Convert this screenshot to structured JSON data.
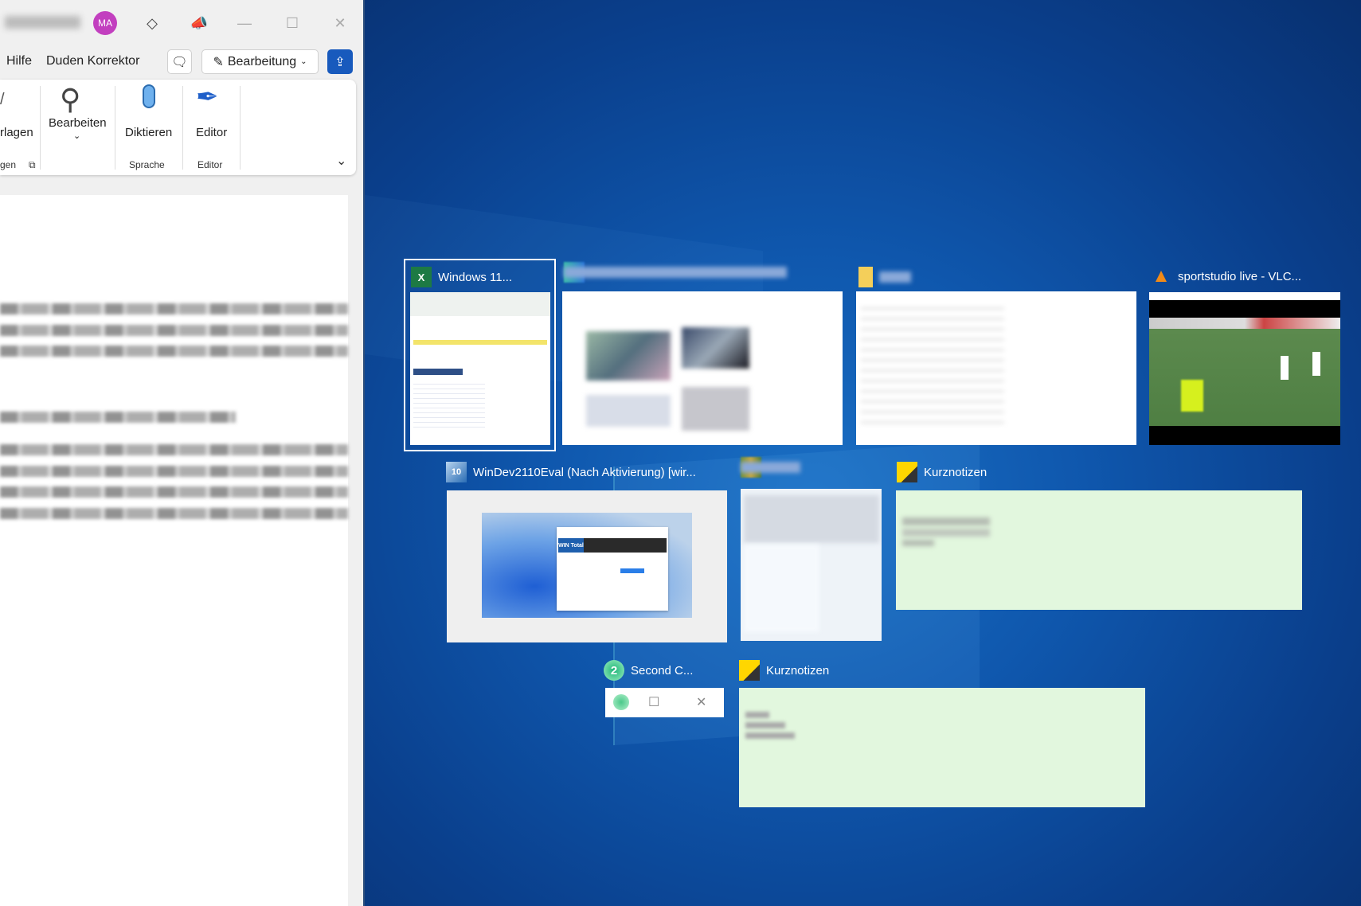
{
  "word": {
    "avatar": "MA",
    "menu": {
      "hilfe": "Hilfe",
      "duden": "Duden Korrektor"
    },
    "mode_button": "Bearbeitung",
    "ribbon": {
      "partial_button": "rlagen",
      "partial_group": "gen",
      "bearbeiten": "Bearbeiten",
      "diktieren": "Diktieren",
      "editor": "Editor",
      "group_sprache": "Sprache",
      "group_editor": "Editor"
    }
  },
  "task_view": {
    "windows": [
      {
        "title": "Windows 11...",
        "app": "excel-icon",
        "selected": true
      },
      {
        "title": "",
        "app": "browser-icon",
        "blurred": true
      },
      {
        "title": "",
        "app": "folder-icon",
        "blurred": true
      },
      {
        "title": "sportstudio live - VLC...",
        "app": "vlc-icon"
      },
      {
        "title": "WinDev2110Eval (Nach Aktivierung) [wir...",
        "app": "virtualbox-icon"
      },
      {
        "title": "",
        "app": "app-icon",
        "blurred": true
      },
      {
        "title": "Kurznotizen",
        "app": "sticky-notes-icon"
      },
      {
        "title": "Second C...",
        "app": "second-copy-icon"
      },
      {
        "title": "Kurznotizen",
        "app": "sticky-notes-icon"
      }
    ],
    "vm_inner": {
      "brand": "WIN Total"
    }
  },
  "colors": {
    "accent": "#185abd",
    "avatar": "#c23fbf",
    "sticky": "#e2f7de",
    "desktop": "#0f57ad"
  }
}
